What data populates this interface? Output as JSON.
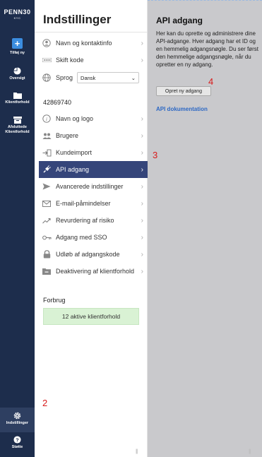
{
  "brand": {
    "name": "PENN30",
    "sub": "KYC"
  },
  "rail": {
    "items": [
      {
        "label": "Tilføj ny",
        "icon": "plus-icon"
      },
      {
        "label": "Oversigt",
        "icon": "pie-chart-icon"
      },
      {
        "label": "Klientforhold",
        "icon": "folder-icon"
      },
      {
        "label": "Afsluttede Klientforhold",
        "icon": "archive-box-icon"
      },
      {
        "label": "Indstillinger",
        "icon": "gear-icon"
      },
      {
        "label": "Støtte",
        "icon": "help-icon"
      }
    ]
  },
  "settings": {
    "title": "Indstillinger",
    "top_items": [
      {
        "label": "Navn og kontaktinfo",
        "icon": "user-circle-icon"
      },
      {
        "label": "Skift kode",
        "icon": "password-dots-icon"
      }
    ],
    "language": {
      "label": "Sprog",
      "value": "Dansk",
      "icon": "globe-icon"
    },
    "company_id": "42869740",
    "company_items": [
      {
        "label": "Navn og logo",
        "icon": "info-icon"
      },
      {
        "label": "Brugere",
        "icon": "users-icon"
      },
      {
        "label": "Kundeimport",
        "icon": "import-icon"
      },
      {
        "label": "API adgang",
        "icon": "plug-icon"
      },
      {
        "label": "Avancerede indstillinger",
        "icon": "send-icon"
      },
      {
        "label": "E-mail-påmindelser",
        "icon": "envelope-icon"
      },
      {
        "label": "Revurdering af risiko",
        "icon": "trend-icon"
      },
      {
        "label": "Adgang med SSO",
        "icon": "key-icon"
      },
      {
        "label": "Udløb af adgangskode",
        "icon": "lock-icon"
      },
      {
        "label": "Deaktivering af klientforhold",
        "icon": "folder-minus-icon"
      }
    ],
    "usage": {
      "label": "Forbrug",
      "value": "12 aktive klientforhold"
    }
  },
  "api": {
    "title": "API adgang",
    "description": "Her kan du oprette og administrere dine API-adgange. Hver adgang har et ID og en hemmelig adgangsnøgle. Du ser først den hemmelige adgangsnøgle, når du opretter en ny adgang.",
    "create_button": "Opret ny adgang",
    "doc_link": "API dokumentation"
  },
  "markers": {
    "m2": "2",
    "m3": "3",
    "m4": "4"
  },
  "colors": {
    "rail": "#1d2d4c",
    "active_row": "#35457a",
    "accent": "#3b8de0",
    "link": "#2d68c4",
    "usage_bg": "#d9f2d4"
  }
}
